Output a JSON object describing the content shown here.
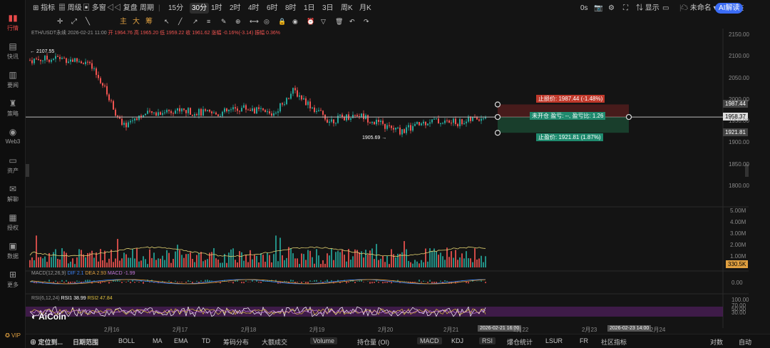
{
  "sidebar": [
    {
      "label": "行情",
      "icon": "bar-chart-icon",
      "active": true
    },
    {
      "label": "快讯",
      "icon": "news-icon"
    },
    {
      "label": "要闻",
      "icon": "headline-icon"
    },
    {
      "label": "策略",
      "icon": "strategy-icon"
    },
    {
      "label": "Web3",
      "icon": "web3-icon"
    },
    {
      "label": "资产",
      "icon": "wallet-icon"
    },
    {
      "label": "解聊",
      "icon": "chat-icon"
    },
    {
      "label": "授权",
      "icon": "auth-icon"
    },
    {
      "label": "数据",
      "icon": "data-icon"
    },
    {
      "label": "更多",
      "icon": "more-icon"
    }
  ],
  "sidebar_bottom": "VIP",
  "toolbar1": {
    "items": [
      "指标",
      "周级",
      "多窗",
      "复盘",
      "周期"
    ],
    "periods": [
      "15分",
      "30分",
      "1时",
      "2时",
      "4时",
      "6时",
      "8时",
      "1日",
      "3日",
      "周K",
      "月K"
    ],
    "selected_period": "30分",
    "right": [
      "0s",
      "显示",
      "未命名",
      "AI解读"
    ]
  },
  "toolbar2": {
    "indicators": [
      "主",
      "大",
      "筹"
    ]
  },
  "legend": {
    "symbol": "ETH/USDT永续",
    "time": "2026-02-21 11:00",
    "open": "开 1964.76",
    "high": "高 1965.20",
    "low": "低 1959.22",
    "close": "收 1961.62",
    "change": "涨幅 -0.16%(-3.14)",
    "amplitude": "振幅 0.36%"
  },
  "price_axis": [
    "2150.00",
    "2100.00",
    "2050.00",
    "2000.00",
    "1950.00",
    "1900.00",
    "1850.00",
    "1800.00"
  ],
  "price_tags": {
    "tp": "1987.44",
    "current": "1958.37",
    "sl": "1921.81"
  },
  "markers": {
    "high": "2107.55",
    "low": "1905.69"
  },
  "order": {
    "stop_loss": "止损价: 1987.44 (-1.48%)",
    "info": "未开仓  盈亏: --, 盈亏比: 1.26",
    "take_profit": "止盈价: 1921.81 (1.87%)"
  },
  "volume_axis": [
    "5.00M",
    "4.00M",
    "3.00M",
    "2.00M",
    "1.00M"
  ],
  "volume_tag": "330.5K",
  "macd_legend": {
    "name": "MACD(12,26,9)",
    "dif": "DIF 2.1",
    "dea": "DEA 2.93",
    "macd": "MACD -1.99"
  },
  "macd_axis": [
    "0.00"
  ],
  "rsi_legend": {
    "name": "RSI(6,12,24)",
    "rsi1": "RSI1 38.99",
    "rsi2": "RSI2 47.84"
  },
  "rsi_axis": [
    "100.00",
    "70.00",
    "50.00",
    "30.00"
  ],
  "x_axis": [
    "2月16",
    "2月17",
    "2月18",
    "2月19",
    "2月20",
    "2月21",
    "2月22",
    "2月23",
    "2月24"
  ],
  "time_cursor": "2026-02-21 16:00",
  "time_cursor2": "2026-02-23 14:00",
  "watermark": "AiCoin",
  "bottom_bar": {
    "left": [
      "定位到...",
      "日期范围"
    ],
    "indicators": [
      "BOLL",
      "MA",
      "EMA",
      "TD",
      "筹码分布",
      "大额成交",
      "Volume",
      "持仓量 (OI)",
      "MACD",
      "KDJ",
      "RSI",
      "爆仓统计",
      "LSUR",
      "FR",
      "社区指标"
    ],
    "selected": [
      "Volume",
      "MACD",
      "RSI"
    ],
    "right": [
      "对数",
      "自动"
    ]
  },
  "colors": {
    "up": "#26a69a",
    "down": "#ef5350",
    "bg": "#141414",
    "accent": "#e84a4a"
  }
}
